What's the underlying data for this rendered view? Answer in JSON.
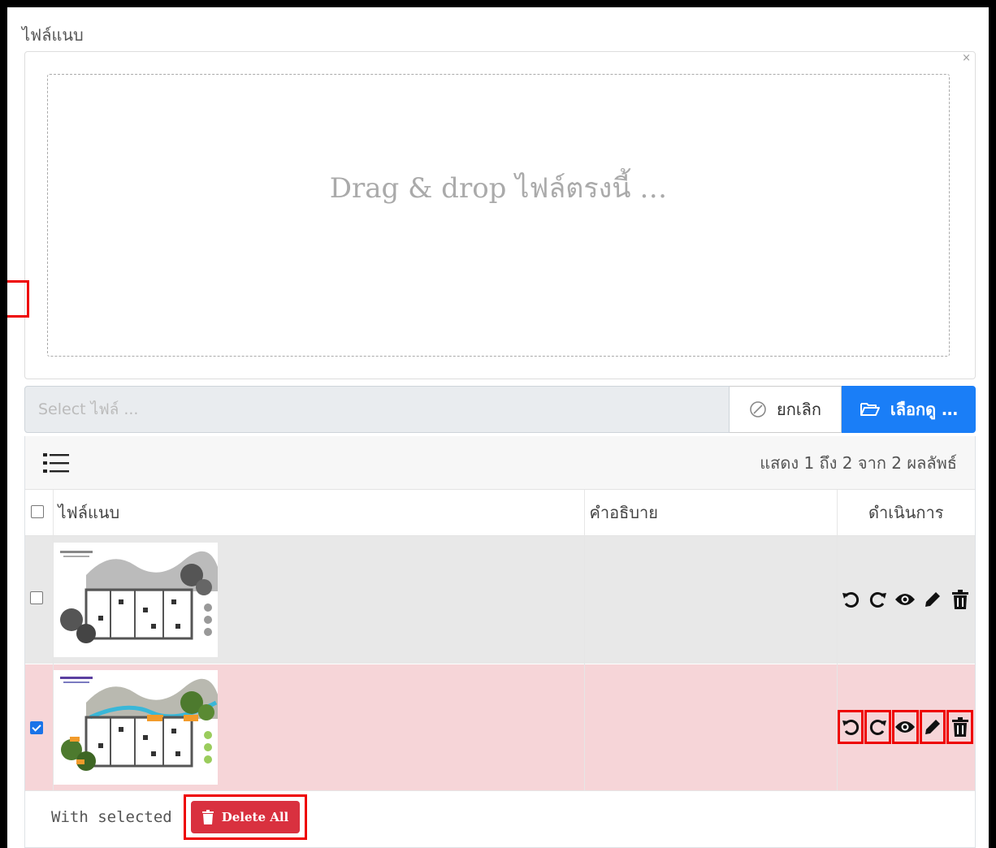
{
  "section_title": "ไฟล์แนบ",
  "drop_zone": {
    "close_glyph": "×",
    "text": "Drag & drop ไฟล์ตรงนี้ …"
  },
  "file_input": {
    "placeholder": "Select ไฟล์ ...",
    "cancel_label": "ยกเลิก",
    "browse_label": "เลือกดู …"
  },
  "table": {
    "summary": "แสดง 1 ถึง 2 จาก 2 ผลลัพธ์",
    "headers": {
      "file": "ไฟล์แนบ",
      "description": "คำอธิบาย",
      "actions": "ดำเนินการ"
    },
    "rows": [
      {
        "checked": false,
        "description": "",
        "highlight": "#e8e8e8"
      },
      {
        "checked": true,
        "description": "",
        "highlight": "#f6d5d8"
      }
    ],
    "action_icons": [
      "rotate-left-icon",
      "rotate-right-icon",
      "eye-icon",
      "pencil-icon",
      "trash-icon"
    ]
  },
  "footer": {
    "with_selected": "With selected",
    "delete_all_label": "Delete All"
  },
  "colors": {
    "primary": "#1a7ef7",
    "danger": "#d9313f",
    "selected_row": "#f6d5d8",
    "annotation_box": "#ee0000"
  }
}
